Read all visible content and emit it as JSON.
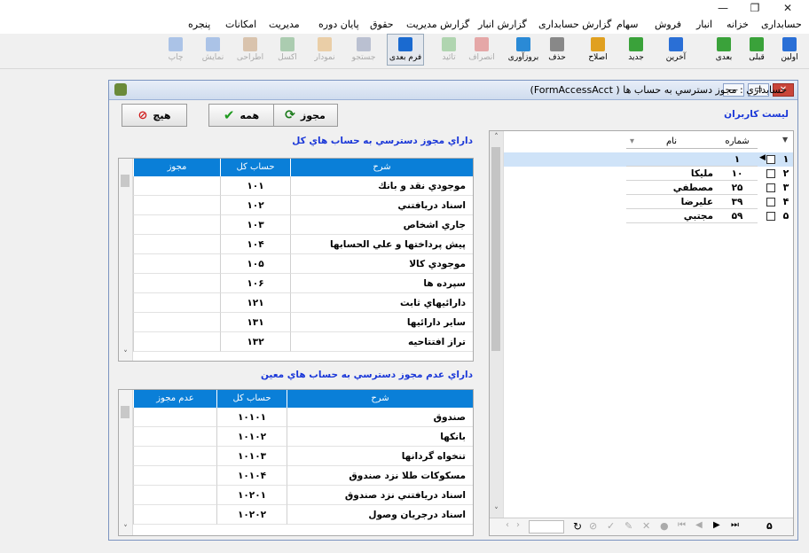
{
  "window_controls": {
    "close": "✕",
    "restore": "❐",
    "minimize": "—"
  },
  "menu": [
    "حسابداری",
    "خزانه",
    "انبار",
    "فروش",
    "سهام",
    "گزارش حسابداری",
    "گزارش انبار",
    "گزارش مدیریت",
    "حقوق",
    "پایان دوره",
    "مدیریت",
    "امکانات",
    "پنجره"
  ],
  "toolbar": [
    "اولین",
    "قبلی",
    "بعدی",
    "آخرین",
    "جدید",
    "اصلاح",
    "حذف",
    "بروزآوری",
    "انصراف",
    "تائید",
    "فرم بعدی",
    "جستجو",
    "نمودار",
    "اکسل",
    "اطراحی",
    "نمایش",
    "چاپ"
  ],
  "toolbar_colors": [
    "#2a6fd6",
    "#3aa23a",
    "#3aa23a",
    "#2a6fd6",
    "#3aa23a",
    "#e0a020",
    "#888888",
    "#2a8ad6",
    "#d02020",
    "#3aa23a",
    "#1a6ad0",
    "#556699",
    "#e09020",
    "#2a8a3a",
    "#b07030",
    "#2a6fd6",
    "#2a6fd6"
  ],
  "form": {
    "title": "حسابداري : مجوز دسترسي به حساب ها ( FormAccessAcct)",
    "btn_grant": "مجوز",
    "btn_all": "همه",
    "btn_none": "هيچ",
    "users_label": "ليست كاربران",
    "allowed_label": "داراي مجوز دسترسي به حساب هاي كل",
    "denied_label": "داراي عدم مجوز دسترسي به حساب هاي معين"
  },
  "grid_allowed": {
    "headers": [
      "شرح",
      "حساب كل",
      "مجوز"
    ],
    "rows": [
      [
        "موجودي نقد و بانك",
        "۱۰۱"
      ],
      [
        "اسناد دريافتني",
        "۱۰۲"
      ],
      [
        "جاري اشخاص",
        "۱۰۳"
      ],
      [
        "پيش پرداختها و علي الحسابها",
        "۱۰۴"
      ],
      [
        "موجودي كالا",
        "۱۰۵"
      ],
      [
        "سپرده ها",
        "۱۰۶"
      ],
      [
        "دارائيهاي ثابت",
        "۱۲۱"
      ],
      [
        "ساير دارائيها",
        "۱۳۱"
      ],
      [
        "تراز افتتاحيه",
        "۱۳۲"
      ]
    ]
  },
  "grid_denied": {
    "headers": [
      "شرح",
      "حساب كل",
      "عدم مجوز"
    ],
    "rows": [
      [
        "صندوق",
        "۱۰۱۰۱"
      ],
      [
        "بانكها",
        "۱۰۱۰۲"
      ],
      [
        "تنخواه گردانها",
        "۱۰۱۰۳"
      ],
      [
        "مسكوكات طلا نزد صندوق",
        "۱۰۱۰۴"
      ],
      [
        "اسناد  دريافتني نزد صندوق",
        "۱۰۲۰۱"
      ],
      [
        "اسناد درجريان وصول",
        "۱۰۲۰۲"
      ]
    ]
  },
  "users": {
    "headers": [
      "شماره",
      "نام"
    ],
    "rows": [
      {
        "idx": "۱",
        "num": "۱",
        "name": ""
      },
      {
        "idx": "۲",
        "num": "۱۰",
        "name": "مليكا"
      },
      {
        "idx": "۳",
        "num": "۲۵",
        "name": "مصطفي"
      },
      {
        "idx": "۴",
        "num": "۳۹",
        "name": "عليرضا"
      },
      {
        "idx": "۵",
        "num": "۵۹",
        "name": "مجتبي"
      }
    ],
    "record_count": "۵"
  }
}
